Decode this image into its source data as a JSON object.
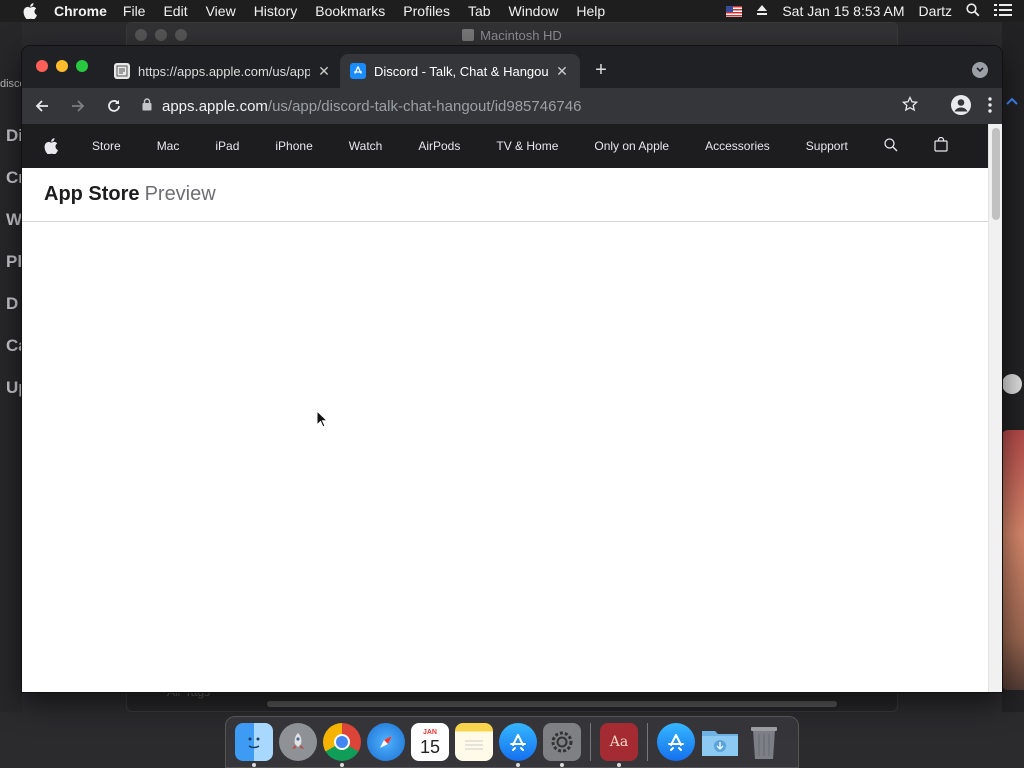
{
  "menubar": {
    "app_name": "Chrome",
    "menus": [
      "File",
      "Edit",
      "View",
      "History",
      "Bookmarks",
      "Profiles",
      "Tab",
      "Window",
      "Help"
    ],
    "datetime": "Sat Jan 15  8:53 AM",
    "user": "Dartz"
  },
  "background_window": {
    "title": "Macintosh HD",
    "footer_label": "Air Tags"
  },
  "left_strip": {
    "labels": [
      "Di",
      "Cr",
      "W",
      "Pl",
      "D",
      "Ca",
      "Up"
    ],
    "partial_text": "disco"
  },
  "browser": {
    "tabs": [
      {
        "title": "https://apps.apple.com/us/app",
        "active": false
      },
      {
        "title": "Discord - Talk, Chat & Hangout",
        "active": true
      }
    ],
    "address": {
      "host": "apps.apple.com",
      "path": "/us/app/discord-talk-chat-hangout/id985746746"
    }
  },
  "apple_nav": {
    "items": [
      "Store",
      "Mac",
      "iPad",
      "iPhone",
      "Watch",
      "AirPods",
      "TV & Home",
      "Only on Apple",
      "Accessories",
      "Support"
    ]
  },
  "subnav": {
    "brand": "App Store",
    "suffix": "Preview"
  },
  "dock": {
    "apps": [
      "finder-icon",
      "launchpad-icon",
      "chrome-icon",
      "safari-icon",
      "calendar-icon",
      "notes-icon",
      "app-store-icon",
      "system-preferences-icon",
      "dictionary-icon",
      "app-store-alt-icon",
      "downloads-folder-icon",
      "trash-icon"
    ],
    "calendar_month": "JAN",
    "calendar_day": "15",
    "dictionary_label": "Aa"
  },
  "colors": {
    "apple_nav_bg": "#1d1d1f",
    "chrome_dark": "#202124",
    "chrome_toolbar": "#35363a"
  }
}
